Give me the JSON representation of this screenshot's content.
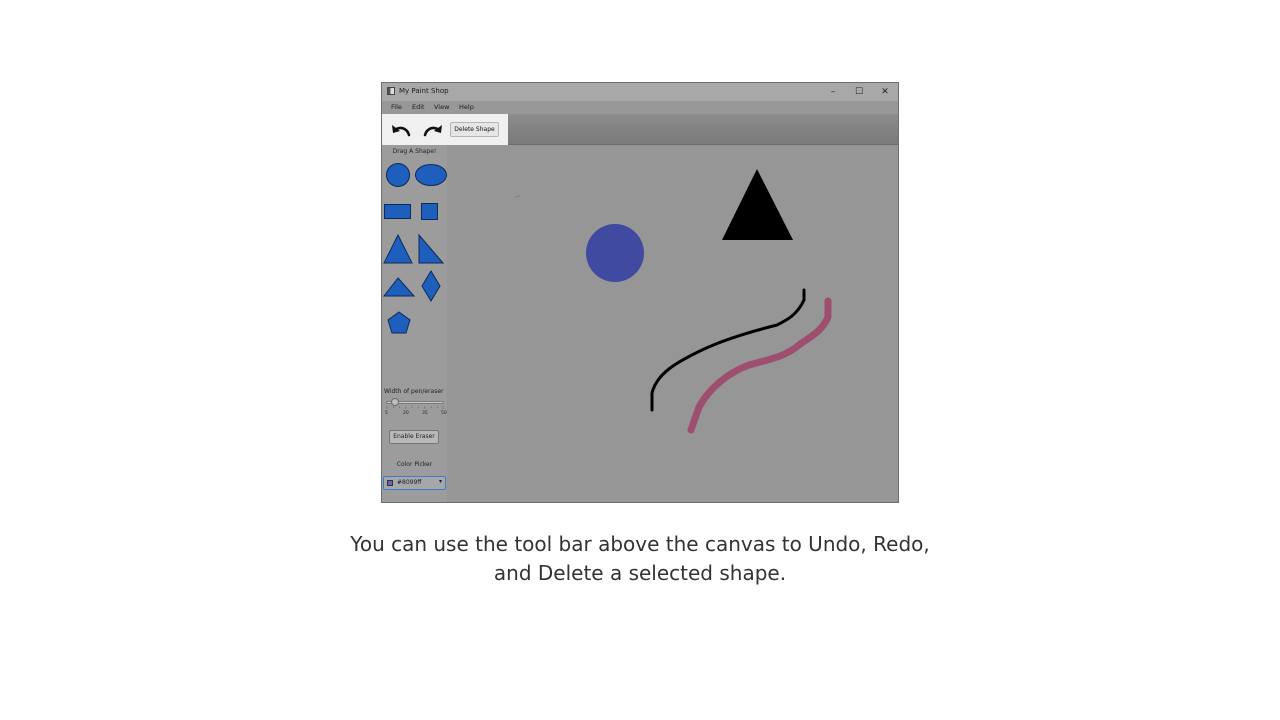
{
  "window": {
    "title": "My Paint Shop",
    "controls": {
      "minimize": "–",
      "maximize": "☐",
      "close": "✕"
    }
  },
  "menu": {
    "items": [
      "File",
      "Edit",
      "View",
      "Help"
    ]
  },
  "toolbar": {
    "undo_icon": "undo-arrow-icon",
    "redo_icon": "redo-arrow-icon",
    "delete_label": "Delete Shape"
  },
  "sidebar": {
    "heading": "Drag A Shape!",
    "shapes": [
      "circle",
      "ellipse",
      "rectangle",
      "square",
      "triangle",
      "right-triangle",
      "wide-triangle",
      "diamond",
      "pentagon"
    ],
    "width_label": "Width of pen/eraser",
    "slider": {
      "value": 10,
      "min": 5,
      "max": 50,
      "tick_labels": [
        "5",
        "20",
        "35",
        "50"
      ]
    },
    "eraser_label": "Enable Eraser",
    "color_picker_label": "Color Picker",
    "color_value": "#8099ff"
  },
  "canvas": {
    "shapes": [
      {
        "type": "circle",
        "color": "#3f4aa0"
      },
      {
        "type": "triangle",
        "color": "#000000"
      },
      {
        "type": "stroke",
        "color": "#000000"
      },
      {
        "type": "stroke",
        "color": "#9e4e6e"
      }
    ]
  },
  "colors": {
    "shape_fill": "#1e5fbe",
    "shape_stroke": "#0d2a55",
    "overlay_gray": "#969696",
    "accent_blue": "#3a7fcf"
  },
  "caption": {
    "line1": "You can use the tool bar above the canvas to Undo, Redo,",
    "line2": "and Delete a selected shape."
  }
}
